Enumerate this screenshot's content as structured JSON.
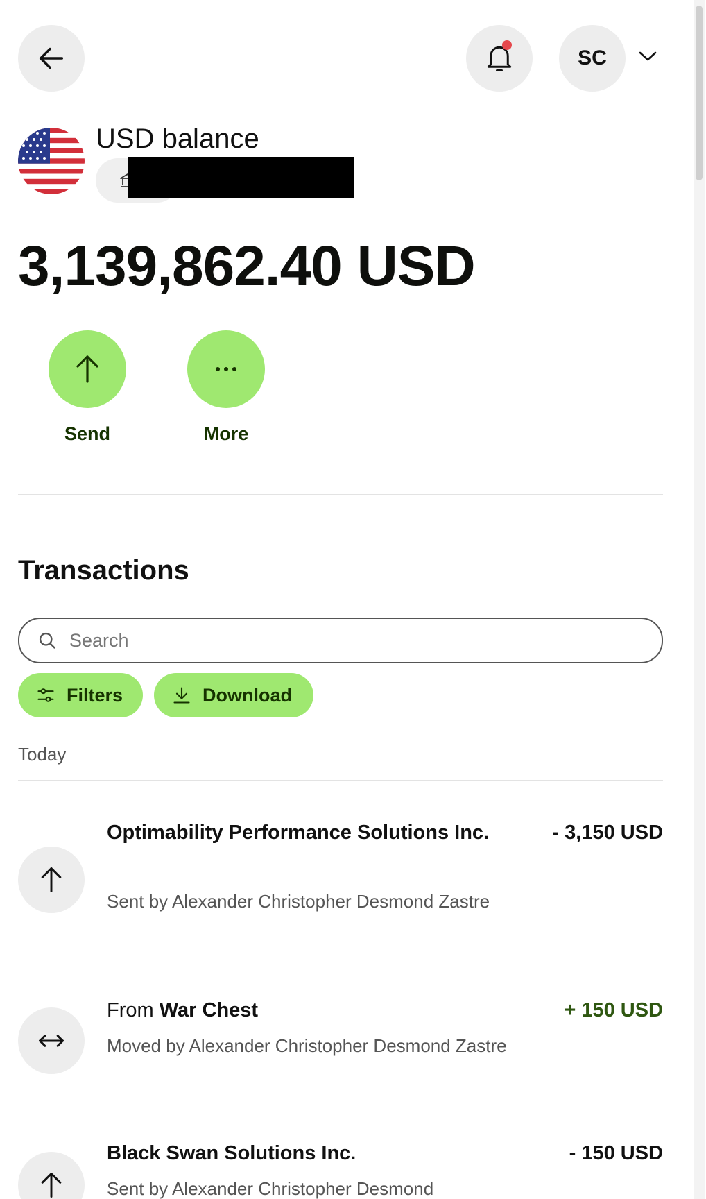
{
  "header": {
    "back_label": "Back",
    "avatar_initials": "SC",
    "has_unread_notifications": true,
    "notification_dot_color": "#e5484d"
  },
  "balance": {
    "title": "USD balance",
    "amount": "3,139,862.40 USD",
    "flag": "us-flag"
  },
  "actions": [
    {
      "label": "Send",
      "icon": "arrow-up-icon"
    },
    {
      "label": "More",
      "icon": "more-horizontal-icon"
    }
  ],
  "transactions": {
    "title": "Transactions",
    "search": {
      "placeholder": "Search",
      "value": ""
    },
    "filters_label": "Filters",
    "download_label": "Download",
    "groups": [
      {
        "date_label": "Today",
        "items": [
          {
            "icon": "arrow-up-icon",
            "title": "Optimability Performance Solutions Inc.",
            "subtitle": "Sent by Alexander Christopher Desmond Zastre",
            "amount": "- 3,150 USD"
          },
          {
            "icon": "arrows-left-right-icon",
            "title_prefix": "From",
            "title": "War Chest",
            "subtitle": "Moved by Alexander Christopher Desmond Zastre",
            "amount": "+ 150 USD"
          },
          {
            "icon": "arrow-up-icon",
            "title": "Black Swan Solutions Inc.",
            "subtitle": "Sent by Alexander Christopher Desmond",
            "amount": "- 150 USD"
          }
        ]
      }
    ]
  },
  "colors": {
    "accent_green": "#9fe870",
    "accent_text": "#163300",
    "positive_amount": "#2f5711"
  }
}
